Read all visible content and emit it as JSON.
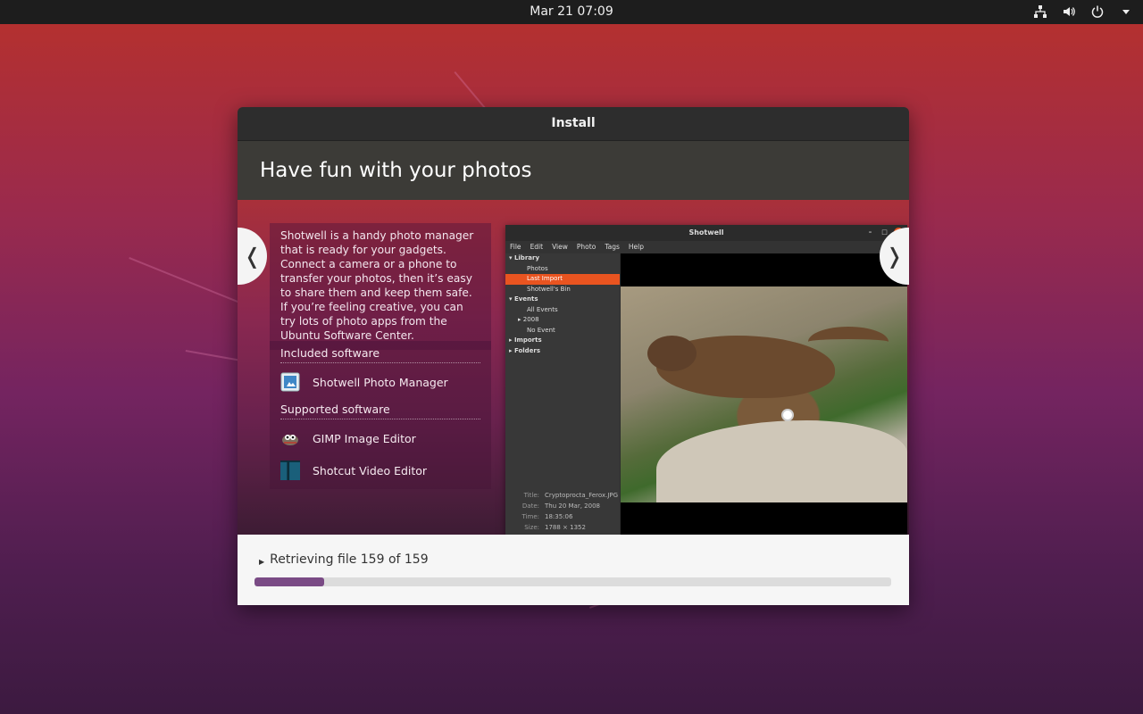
{
  "topbar": {
    "clock": "Mar 21  07:09",
    "tray_icons": [
      "network-icon",
      "volume-icon",
      "power-icon",
      "chevron-down-icon"
    ]
  },
  "window": {
    "title": "Install",
    "heading": "Have fun with your photos",
    "description": "Shotwell is a handy photo manager that is ready for your gadgets. Connect a camera or a phone to transfer your photos, then it’s easy to share them and keep them safe. If you’re feeling creative, you can try lots of photo apps from the Ubuntu Software Center.",
    "included_header": "Included software",
    "included": [
      {
        "name": "Shotwell Photo Manager",
        "icon": "shotwell-icon"
      }
    ],
    "supported_header": "Supported software",
    "supported": [
      {
        "name": "GIMP Image Editor",
        "icon": "gimp-icon"
      },
      {
        "name": "Shotcut Video Editor",
        "icon": "shotcut-icon"
      }
    ],
    "prev_label": "❬",
    "next_label": "❭"
  },
  "screenshot": {
    "title": "Shotwell",
    "menu": [
      "File",
      "Edit",
      "View",
      "Photo",
      "Tags",
      "Help"
    ],
    "sidebar": [
      {
        "label": "▾ Library",
        "indent": 0,
        "bold": true
      },
      {
        "label": "Photos",
        "indent": 2
      },
      {
        "label": "Last Import",
        "indent": 2,
        "selected": true
      },
      {
        "label": "Shotwell's Bin",
        "indent": 2
      },
      {
        "label": "▾ Events",
        "indent": 0,
        "bold": true
      },
      {
        "label": "All Events",
        "indent": 2
      },
      {
        "label": "▸ 2008",
        "indent": 1
      },
      {
        "label": "No Event",
        "indent": 2
      },
      {
        "label": "▸ Imports",
        "indent": 0,
        "bold": true
      },
      {
        "label": "▸ Folders",
        "indent": 0,
        "bold": true
      }
    ],
    "meta": [
      {
        "k": "Title:",
        "v": "Cryptoprocta_Ferox.JPG"
      },
      {
        "k": "Date:",
        "v": "Thu 20 Mar, 2008"
      },
      {
        "k": "Time:",
        "v": "18:35:06"
      },
      {
        "k": "Size:",
        "v": "1788 × 1352"
      }
    ]
  },
  "footer": {
    "status": "Retrieving file 159 of 159",
    "progress_percent": 11
  }
}
